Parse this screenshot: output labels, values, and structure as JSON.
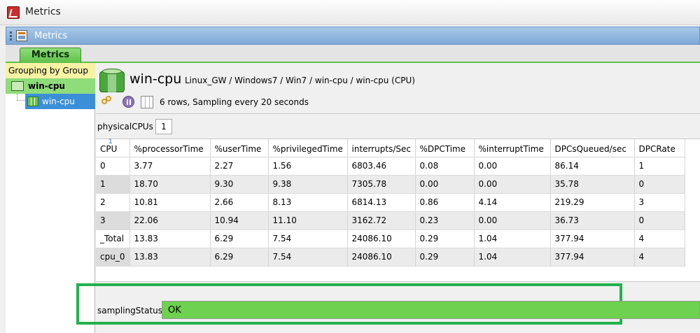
{
  "window": {
    "title": "Metrics"
  },
  "view": {
    "title": "Metrics"
  },
  "tabs": [
    {
      "label": "Metrics"
    }
  ],
  "sidebar": {
    "grouping_label": "Grouping by Group",
    "group": "win-cpu",
    "item": "win-cpu"
  },
  "header": {
    "name": "win-cpu",
    "path": "Linux_GW / Windows7 / Win7 / win-cpu / win-cpu (CPU)",
    "status": "6 rows, Sampling every 20 seconds"
  },
  "parameter": {
    "label": "physicalCPUs",
    "value": "1"
  },
  "table": {
    "sort_indicator": "1",
    "columns": [
      "CPU",
      "%processorTime",
      "%userTime",
      "%privilegedTime",
      "interrupts/Sec",
      "%DPCTime",
      "%interruptTime",
      "DPCsQueued/sec",
      "DPCRate"
    ],
    "rows": [
      [
        "0",
        "3.77",
        "2.27",
        "1.56",
        "6803.46",
        "0.08",
        "0.00",
        "86.14",
        "1"
      ],
      [
        "1",
        "18.70",
        "9.30",
        "9.38",
        "7305.78",
        "0.00",
        "0.00",
        "35.78",
        "0"
      ],
      [
        "2",
        "10.81",
        "2.66",
        "8.13",
        "6814.13",
        "0.86",
        "4.14",
        "219.29",
        "3"
      ],
      [
        "3",
        "22.06",
        "10.94",
        "11.10",
        "3162.72",
        "0.23",
        "0.00",
        "36.73",
        "0"
      ],
      [
        "_Total",
        "13.83",
        "6.29",
        "7.54",
        "24086.10",
        "0.29",
        "1.04",
        "377.94",
        "4"
      ],
      [
        "cpu_0",
        "13.83",
        "6.29",
        "7.54",
        "24086.10",
        "0.29",
        "1.04",
        "377.94",
        "4"
      ]
    ]
  },
  "sampling": {
    "label": "samplingStatus",
    "value": "OK"
  },
  "colors": {
    "ok_green": "#6ed14f",
    "tab_green": "#5fc04a",
    "highlight": "#22b24c",
    "selection": "#3b8fd8"
  },
  "icons": [
    "app-icon",
    "view-icon",
    "folder-icon",
    "grid-icon",
    "refresh-icon",
    "pause-icon",
    "table-icon"
  ]
}
